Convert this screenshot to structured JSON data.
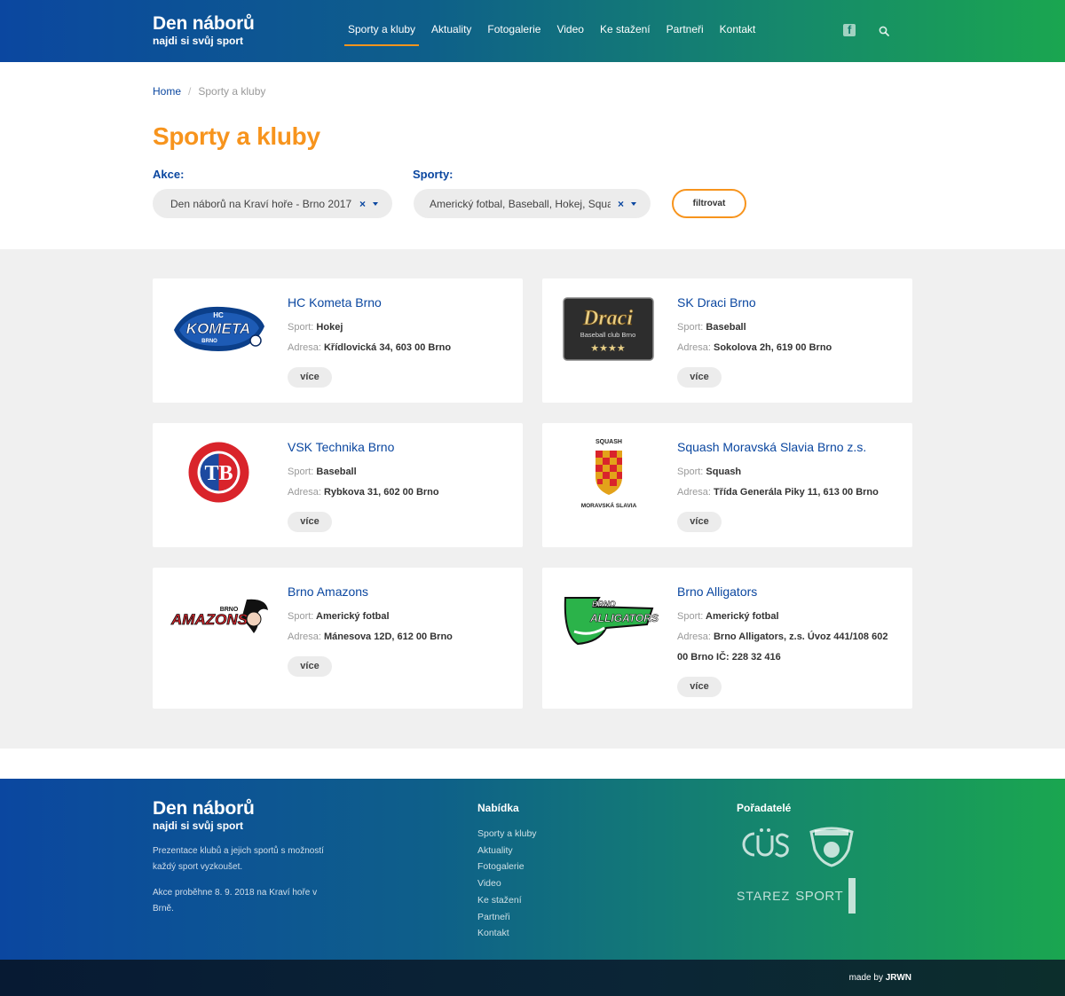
{
  "brand": {
    "title": "Den náborů",
    "subtitle": "najdi si svůj sport"
  },
  "nav": [
    {
      "label": "Sporty a kluby"
    },
    {
      "label": "Aktuality"
    },
    {
      "label": "Fotogalerie"
    },
    {
      "label": "Video"
    },
    {
      "label": "Ke stažení"
    },
    {
      "label": "Partneři"
    },
    {
      "label": "Kontakt"
    }
  ],
  "header_icons": {
    "social": "facebook-icon",
    "search": "search-icon"
  },
  "breadcrumb": {
    "home": "Home",
    "separator": "/",
    "current": "Sporty a kluby"
  },
  "page_title": "Sporty a kluby",
  "filters": {
    "akce_label": "Akce:",
    "akce_value": "Den náborů na Kraví hoře - Brno 2017",
    "sporty_label": "Sporty:",
    "sporty_value": "Americký fotbal, Baseball, Hokej, Squash",
    "clear": "×",
    "button": "filtrovat"
  },
  "labels": {
    "sport": "Sport:",
    "address": "Adresa:",
    "more": "více"
  },
  "clubs": [
    {
      "name": "HC Kometa Brno",
      "sport": "Hokej",
      "address": "Křídlovická 34, 603 00 Brno",
      "logo": {
        "line1": "HC",
        "line2": "KOMETA",
        "line3": "BRNO"
      }
    },
    {
      "name": "SK Draci Brno",
      "sport": "Baseball",
      "address": "Sokolova 2h, 619 00 Brno",
      "logo": {
        "line1": "Draci",
        "line2": "Baseball club Brno",
        "line3": "★★★★"
      }
    },
    {
      "name": "VSK Technika Brno",
      "sport": "Baseball",
      "address": "Rybkova 31, 602 00 Brno",
      "logo": {
        "line1": "TB"
      }
    },
    {
      "name": "Squash Moravská Slavia Brno z.s.",
      "sport": "Squash",
      "address": "Třída Generála Piky 11, 613 00 Brno",
      "logo": {
        "line1": "SQUASH",
        "line2": "MORAVSKÁ SLAVIA"
      }
    },
    {
      "name": "Brno Amazons",
      "sport": "Americký fotbal",
      "address": "Mánesova 12D, 612 00 Brno",
      "logo": {
        "line1": "BRNO",
        "line2": "AMAZONS"
      }
    },
    {
      "name": "Brno Alligators",
      "sport": "Americký fotbal",
      "address": "Brno Alligators, z.s. Úvoz 441/108 602 00 Brno IČ: 228 32 416",
      "logo": {
        "line1": "BRNO",
        "line2": "ALLIGATORS"
      }
    }
  ],
  "footer": {
    "brand_title": "Den náborů",
    "brand_subtitle": "najdi si svůj sport",
    "desc1": "Prezentace klubů a jejich sportů s možností každý sport vyzkoušet.",
    "desc2": "Akce proběhne 8. 9. 2018 na Kraví hoře v Brně.",
    "menu_title": "Nabídka",
    "menu": [
      "Sporty a kluby",
      "Aktuality",
      "Fotogalerie",
      "Video",
      "Ke stažení",
      "Partneři",
      "Kontakt"
    ],
    "organizers_title": "Pořadatelé",
    "organizer_logo_starez": "STAREZ",
    "organizer_logo_sport": "SPORT"
  },
  "made_by": {
    "prefix": "made by",
    "name": "JRWN"
  },
  "colors": {
    "primary": "#0b47a0",
    "accent": "#f7941d",
    "green": "#1aa650"
  }
}
